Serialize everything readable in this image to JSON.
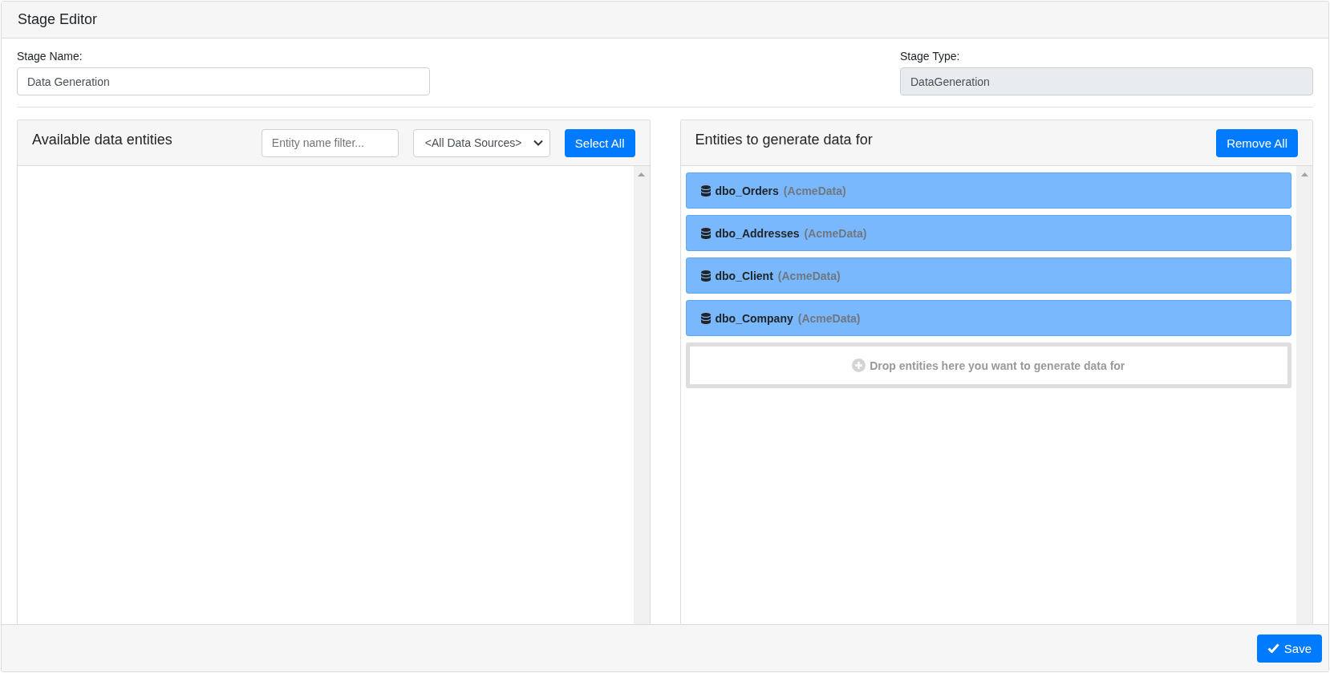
{
  "window": {
    "title": "Stage Editor"
  },
  "stage_name": {
    "label": "Stage Name:",
    "value": "Data Generation"
  },
  "stage_type": {
    "label": "Stage Type:",
    "value": "DataGeneration",
    "disabled": true
  },
  "available_panel": {
    "title": "Available data entities",
    "filter": {
      "placeholder": "Entity name filter..."
    },
    "source_select": {
      "value": "<All Data Sources>"
    },
    "button": "Select All"
  },
  "target_panel": {
    "title": "Entities to generate data for",
    "button": "Remove All",
    "entities": [
      {
        "name": "dbo_Orders",
        "source": "(AcmeData)"
      },
      {
        "name": "dbo_Addresses",
        "source": "(AcmeData)"
      },
      {
        "name": "dbo_Client",
        "source": "(AcmeData)"
      },
      {
        "name": "dbo_Company",
        "source": "(AcmeData)"
      }
    ],
    "drop_hint": "Drop entities here you want to generate data for"
  },
  "footer": {
    "save_button": "Save"
  }
}
